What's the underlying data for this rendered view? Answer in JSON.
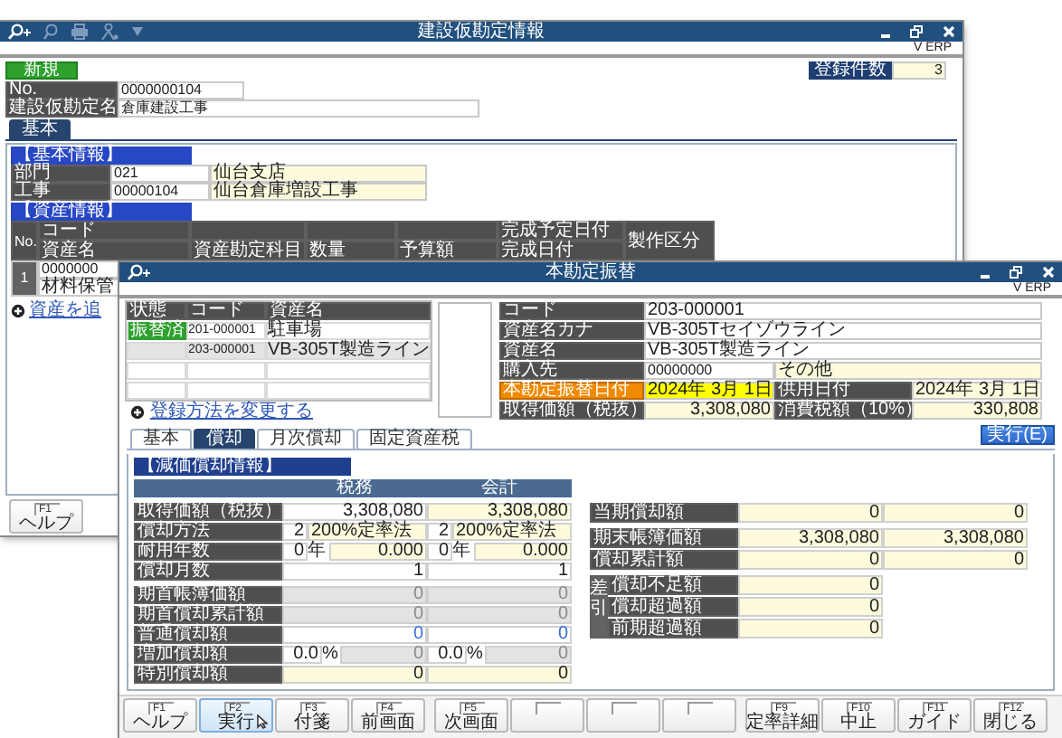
{
  "back_window": {
    "title": "建設仮勘定情報",
    "brand": "V ERP",
    "mode_badge": "新規",
    "count_label": "登録件数",
    "count": "3",
    "fields": [
      {
        "label": "No.",
        "value": "0000000104"
      },
      {
        "label": "建設仮勘定名",
        "value": "倉庫建設工事"
      }
    ],
    "tabs": [
      {
        "label": "基本",
        "selected": true
      }
    ],
    "basic_info": {
      "title": "【基本情報】",
      "rows": [
        {
          "label": "部門",
          "code": "021",
          "name": "仙台支店"
        },
        {
          "label": "工事",
          "code": "00000104",
          "name": "仙台倉庫増設工事"
        }
      ]
    },
    "asset_info": {
      "title": "【資産情報】",
      "columns": [
        {
          "top": "No."
        },
        {
          "top": "コード",
          "bottom": "資産名"
        },
        {
          "bottom": "資産勘定科目"
        },
        {
          "bottom": "数量"
        },
        {
          "bottom": "予算額"
        },
        {
          "top": "完成予定日付",
          "bottom": "完成日付"
        },
        {
          "top": "製作区分"
        }
      ],
      "rows": [
        {
          "no": "1",
          "code": "0000000",
          "name": "材料保管"
        }
      ]
    },
    "add_link": "資産を追",
    "keys": [
      {
        "kind": "key",
        "key": "F1",
        "label": "ヘルプ",
        "highlighted": false
      }
    ]
  },
  "front_window": {
    "title": "本勘定振替",
    "brand": "V ERP",
    "asset_list": {
      "columns": [
        "状態",
        "コード",
        "資産名"
      ],
      "rows": [
        {
          "status": "振替済",
          "code": "201-000001",
          "name": "駐車場",
          "selected": false
        },
        {
          "code": "203-000001",
          "name": "VB-305T製造ライン",
          "selected": true
        }
      ]
    },
    "change_link": "登録方法を変更する",
    "info_rows": [
      {
        "kind": "wide",
        "label": "コード",
        "value": "203-000001"
      },
      {
        "kind": "wide",
        "label": "資産名カナ",
        "value": "VB-305Tセイゾウライン"
      },
      {
        "kind": "wide",
        "label": "資産名",
        "value": "VB-305T製造ライン"
      },
      {
        "kind": "code_name",
        "label": "購入先",
        "code": "00000000",
        "name": "その他"
      },
      {
        "kind": "split",
        "fields": [
          {
            "label": "本勘定振替日付",
            "value": "2024年 3月 1日",
            "highlighted": true
          },
          {
            "label": "供用日付",
            "value": "2024年 3月 1日",
            "highlighted": false
          }
        ]
      },
      {
        "kind": "split",
        "fields": [
          {
            "label": "取得価額（税抜）",
            "value": "3,308,080",
            "highlighted": false
          },
          {
            "label": "消費税額（10%）",
            "value": "330,808",
            "highlighted": false
          }
        ]
      }
    ],
    "execute_button": "実行(E)",
    "tabs": [
      {
        "label": "基本",
        "selected": false
      },
      {
        "label": "償却",
        "selected": true
      },
      {
        "label": "月次償却",
        "selected": false
      },
      {
        "label": "固定資産税",
        "selected": false
      }
    ],
    "depreciation": {
      "title": "【減価償却情報】",
      "columns": [
        "税務",
        "会計"
      ],
      "groups": [
        {
          "rows": [
            {
              "kind": "amount",
              "label": "取得価額（税抜）",
              "cells": [
                [
                  {
                    "text": "3,308,080",
                    "kind": "input"
                  }
                ],
                [
                  {
                    "text": "3,308,080",
                    "kind": "calc"
                  }
                ]
              ]
            },
            {
              "kind": "method",
              "label": "償却方法",
              "cells": [
                [
                  {
                    "text": "2",
                    "kind": "input"
                  },
                  {
                    "text": "200%定率法",
                    "kind": "calc"
                  }
                ],
                [
                  {
                    "text": "2",
                    "kind": "input"
                  },
                  {
                    "text": "200%定率法",
                    "kind": "calc"
                  }
                ]
              ]
            },
            {
              "kind": "years",
              "label": "耐用年数",
              "cells": [
                [
                  {
                    "text": "0",
                    "kind": "input"
                  },
                  {
                    "text": "年",
                    "kind": "unit"
                  },
                  {
                    "text": "0.000",
                    "kind": "calc"
                  }
                ],
                [
                  {
                    "text": "0",
                    "kind": "input"
                  },
                  {
                    "text": "年",
                    "kind": "unit"
                  },
                  {
                    "text": "0.000",
                    "kind": "calc"
                  }
                ]
              ]
            },
            {
              "kind": "amount",
              "label": "償却月数",
              "cells": [
                [
                  {
                    "text": "1",
                    "kind": "input"
                  }
                ],
                [
                  {
                    "text": "1",
                    "kind": "input"
                  }
                ]
              ]
            }
          ]
        },
        {
          "rows": [
            {
              "kind": "amount",
              "label": "期首帳簿価額",
              "cells": [
                [
                  {
                    "text": "0",
                    "kind": "disabled"
                  }
                ],
                [
                  {
                    "text": "0",
                    "kind": "disabled"
                  }
                ]
              ]
            },
            {
              "kind": "amount",
              "label": "期首償却累計額",
              "cells": [
                [
                  {
                    "text": "0",
                    "kind": "disabled"
                  }
                ],
                [
                  {
                    "text": "0",
                    "kind": "disabled"
                  }
                ]
              ]
            },
            {
              "kind": "amount",
              "label": "普通償却額",
              "cells": [
                [
                  {
                    "text": "0",
                    "kind": "linked"
                  }
                ],
                [
                  {
                    "text": "0",
                    "kind": "linked"
                  }
                ]
              ]
            },
            {
              "kind": "rate",
              "label": "増加償却額",
              "cells": [
                [
                  {
                    "text": "0.0",
                    "kind": "input"
                  },
                  {
                    "text": "%",
                    "kind": "unit"
                  },
                  {
                    "text": "0",
                    "kind": "disabled"
                  }
                ],
                [
                  {
                    "text": "0.0",
                    "kind": "input"
                  },
                  {
                    "text": "%",
                    "kind": "unit"
                  },
                  {
                    "text": "0",
                    "kind": "disabled"
                  }
                ]
              ]
            },
            {
              "kind": "amount",
              "label": "特別償却額",
              "cells": [
                [
                  {
                    "text": "0",
                    "kind": "calc"
                  }
                ],
                [
                  {
                    "text": "0",
                    "kind": "calc"
                  }
                ]
              ]
            }
          ]
        },
        {
          "rows": [
            {
              "kind": "amount",
              "label": "当期償却額",
              "cells": [
                [
                  {
                    "text": "0",
                    "kind": "calc"
                  }
                ],
                [
                  {
                    "text": "0",
                    "kind": "calc"
                  }
                ]
              ]
            }
          ]
        },
        {
          "rows": [
            {
              "kind": "amount",
              "label": "期末帳簿価額",
              "cells": [
                [
                  {
                    "text": "3,308,080",
                    "kind": "calc"
                  }
                ],
                [
                  {
                    "text": "3,308,080",
                    "kind": "calc"
                  }
                ]
              ]
            },
            {
              "kind": "amount",
              "label": "償却累計額",
              "cells": [
                [
                  {
                    "text": "0",
                    "kind": "calc"
                  }
                ],
                [
                  {
                    "text": "0",
                    "kind": "calc"
                  }
                ]
              ]
            }
          ]
        },
        {
          "side_label": "差引",
          "rows": [
            {
              "kind": "amount",
              "label": "償却不足額",
              "cells": [
                [
                  {
                    "text": "0",
                    "kind": "calc"
                  }
                ]
              ]
            },
            {
              "kind": "amount",
              "label": "償却超過額",
              "cells": [
                [
                  {
                    "text": "0",
                    "kind": "calc"
                  }
                ]
              ]
            },
            {
              "kind": "amount",
              "label": "前期超過額",
              "cells": [
                [
                  {
                    "text": "0",
                    "kind": "calc"
                  }
                ]
              ]
            }
          ]
        }
      ]
    },
    "keys": [
      {
        "kind": "key",
        "key": "F1",
        "label": "ヘルプ",
        "highlighted": false
      },
      {
        "kind": "key",
        "key": "F2",
        "label": "実行",
        "highlighted": true
      },
      {
        "kind": "key",
        "key": "F3",
        "label": "付箋",
        "highlighted": false
      },
      {
        "kind": "key",
        "key": "F4",
        "label": "前画面",
        "highlighted": false
      },
      {
        "kind": "key",
        "key": "F5",
        "label": "次画面",
        "highlighted": false
      },
      {
        "kind": "blank",
        "highlighted": false
      },
      {
        "kind": "blank",
        "highlighted": false
      },
      {
        "kind": "blank",
        "highlighted": false
      },
      {
        "kind": "key",
        "key": "F9",
        "label": "定率詳細",
        "highlighted": false
      },
      {
        "kind": "key",
        "key": "F10",
        "label": "中止",
        "highlighted": false
      },
      {
        "kind": "key",
        "key": "F11",
        "label": "ガイド",
        "highlighted": false
      },
      {
        "kind": "key",
        "key": "F12",
        "label": "閉じる",
        "highlighted": false
      }
    ]
  }
}
